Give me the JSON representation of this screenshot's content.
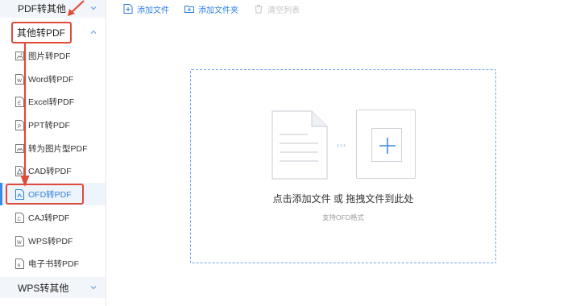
{
  "sidebar": {
    "groups": [
      {
        "label": "PDF转其他",
        "chevron": "chevron-down-icon"
      },
      {
        "label": "其他转PDF",
        "chevron": "chevron-up-icon"
      },
      {
        "label": "WPS转其他",
        "chevron": "chevron-down-icon"
      }
    ],
    "items": [
      {
        "label": "图片转PDF",
        "icon": "image-file-icon"
      },
      {
        "label": "Word转PDF",
        "icon": "word-file-icon"
      },
      {
        "label": "Excel转PDF",
        "icon": "excel-file-icon"
      },
      {
        "label": "PPT转PDF",
        "icon": "ppt-file-icon"
      },
      {
        "label": "转为图片型PDF",
        "icon": "image-pdf-icon"
      },
      {
        "label": "CAD转PDF",
        "icon": "cad-file-icon"
      },
      {
        "label": "OFD转PDF",
        "icon": "pdf-file-icon",
        "active": true
      },
      {
        "label": "CAJ转PDF",
        "icon": "caj-file-icon"
      },
      {
        "label": "WPS转PDF",
        "icon": "wps-file-icon"
      },
      {
        "label": "电子书转PDF",
        "icon": "ebook-file-icon"
      }
    ]
  },
  "toolbar": {
    "add_file": "添加文件",
    "add_folder": "添加文件夹",
    "clear_list": "清空列表"
  },
  "dropzone": {
    "main_text": "点击添加文件 或 拖拽文件到此处",
    "sub_text": "支持OFD格式",
    "chevrons": "›››"
  },
  "colors": {
    "accent": "#2f7fe0",
    "highlight_red": "#e04a3a",
    "dashed_border": "#6aa4e8",
    "active_bg": "#eef4fb"
  }
}
